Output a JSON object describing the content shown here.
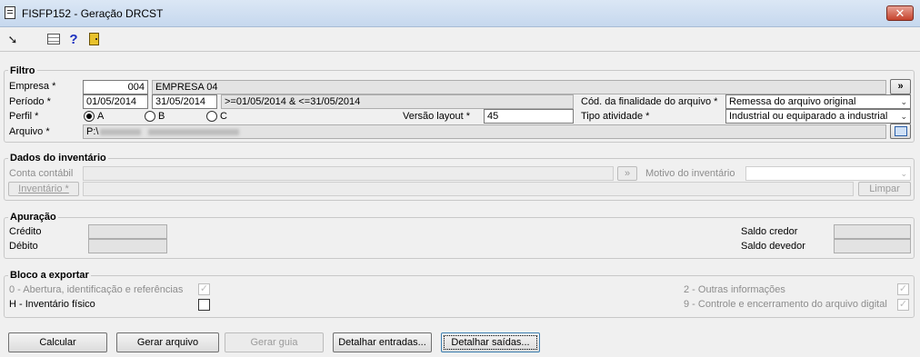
{
  "window": {
    "title": "FISFP152 - Geração DRCST",
    "close_label": "✕"
  },
  "filtro": {
    "legend": "Filtro",
    "empresa_label": "Empresa *",
    "empresa_code": "004",
    "empresa_name": "EMPRESA 04",
    "lookup_button": "»",
    "periodo_label": "Período *",
    "periodo_start": "01/05/2014",
    "periodo_end": "31/05/2014",
    "periodo_expr": ">=01/05/2014 & <=31/05/2014",
    "finalidade_label": "Cód. da finalidade do arquivo *",
    "finalidade_value": "Remessa do arquivo original",
    "perfil_label": "Perfil *",
    "perfil_options": [
      "A",
      "B",
      "C"
    ],
    "perfil_selected": "A",
    "versao_label": "Versão layout *",
    "versao_value": "45",
    "atividade_label": "Tipo atividade *",
    "atividade_value": "Industrial ou equiparado a industrial",
    "arquivo_label": "Arquivo *",
    "arquivo_prefix": "P:\\"
  },
  "inventario": {
    "legend": "Dados do inventário",
    "conta_label": "Conta contábil",
    "motivo_label": "Motivo do inventário",
    "inventario_button": "Inventário *",
    "limpar_button": "Limpar"
  },
  "apuracao": {
    "legend": "Apuração",
    "credito_label": "Crédito",
    "debito_label": "Débito",
    "saldo_credor_label": "Saldo credor",
    "saldo_devedor_label": "Saldo devedor"
  },
  "bloco": {
    "legend": "Bloco a exportar",
    "b0": {
      "label": "0 - Abertura, identificação e referências",
      "checked": true
    },
    "bh": {
      "label": "H - Inventário físico",
      "checked": false
    },
    "b2": {
      "label": "2 - Outras informações",
      "checked": true
    },
    "b9": {
      "label": "9 - Controle e encerramento do arquivo digital",
      "checked": true
    }
  },
  "buttons": {
    "calcular": "Calcular",
    "gerar_arquivo": "Gerar arquivo",
    "gerar_guia": "Gerar guia",
    "detalhar_entradas": "Detalhar entradas...",
    "detalhar_saidas": "Detalhar saídas..."
  },
  "icons": {
    "app": "document-icon",
    "exit": "exit-arrow-icon",
    "grid": "table-icon",
    "help": "help-icon",
    "door": "door-exit-icon"
  }
}
